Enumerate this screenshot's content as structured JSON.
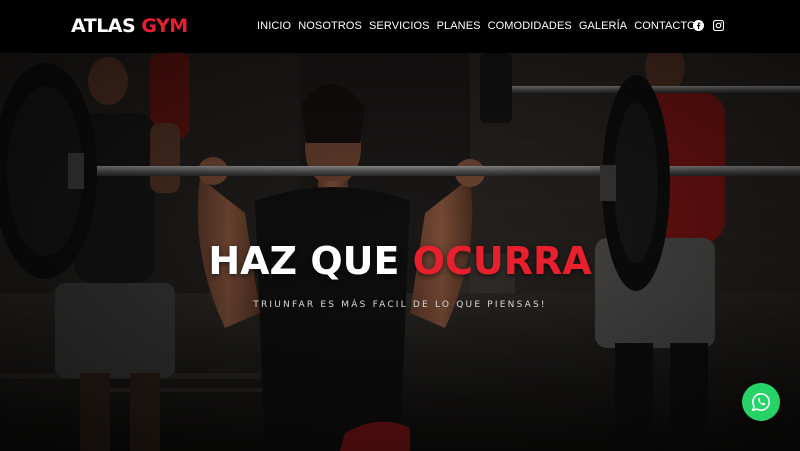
{
  "brand": {
    "word1": "ATLAS",
    "word2": "GYM",
    "accent_color": "#e8202e"
  },
  "nav": {
    "items": [
      {
        "label": "INICIO"
      },
      {
        "label": "NOSOTROS"
      },
      {
        "label": "SERVICIOS"
      },
      {
        "label": "PLANES"
      },
      {
        "label": "COMODIDADES"
      },
      {
        "label": "GALERÍA"
      },
      {
        "label": "CONTACTO"
      }
    ],
    "social_icons": [
      "facebook-icon",
      "instagram-icon"
    ]
  },
  "hero": {
    "headline_white": "HAZ QUE ",
    "headline_red": "OCURRA",
    "tagline": "TRIUNFAR ES MÁS FACIL DE LO QUE PIENSAS!"
  },
  "floating": {
    "whatsapp_icon": "whatsapp-icon",
    "whatsapp_color": "#25d366"
  }
}
